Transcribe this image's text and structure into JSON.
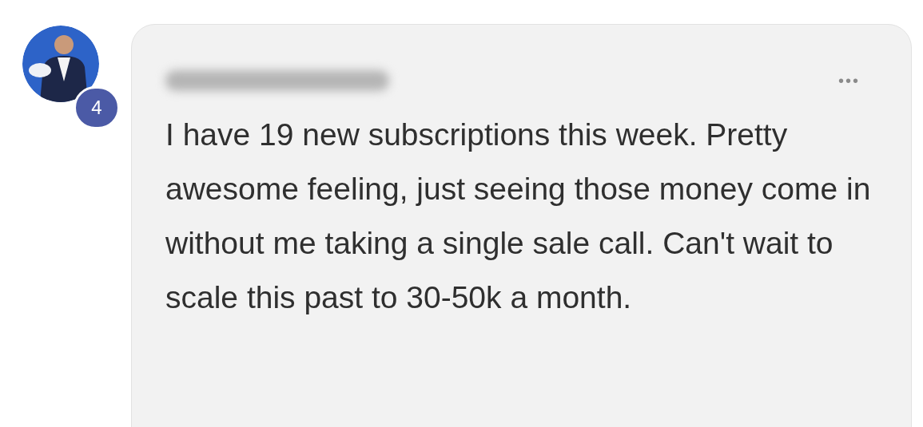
{
  "avatar": {
    "badge": "4"
  },
  "comment": {
    "menu": "•••",
    "text": "I have 19 new subscriptions this week. Pretty awesome feeling, just seeing those money come in without me taking a single sale call. Can't wait to scale this past to 30-50k a month."
  }
}
